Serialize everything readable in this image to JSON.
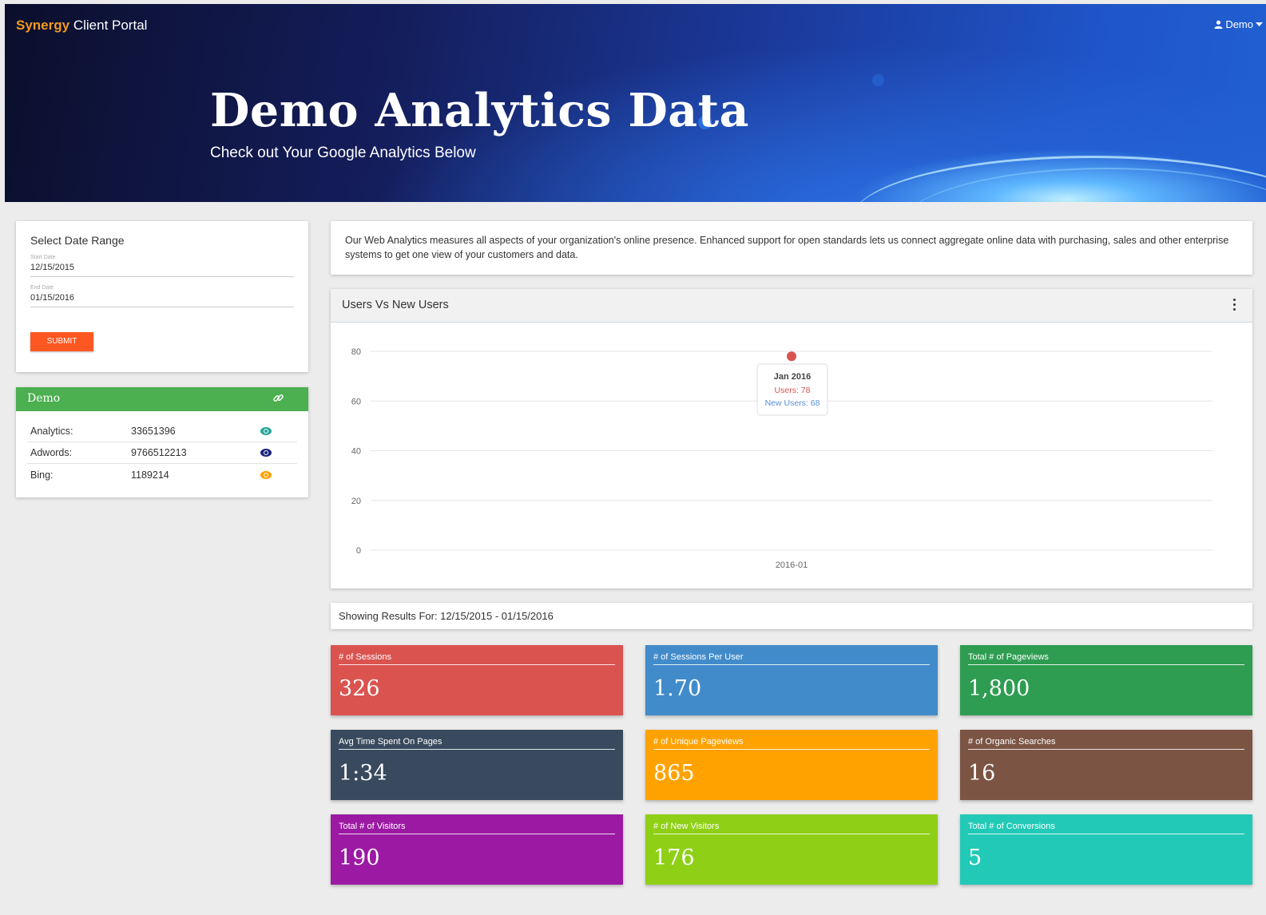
{
  "header": {
    "brand_accent": "Synergy",
    "brand_rest": "Client Portal",
    "user_label": "Demo",
    "title": "Demo Analytics Data",
    "subtitle": "Check out Your Google Analytics Below"
  },
  "date_range": {
    "title": "Select Date Range",
    "start_label": "Start Date",
    "start_value": "12/15/2015",
    "end_label": "End Date",
    "end_value": "01/15/2016",
    "submit_label": "SUBMIT"
  },
  "account": {
    "name": "Demo",
    "rows": [
      {
        "label": "Analytics:",
        "value": "33651396",
        "eye_color": "#26a69a"
      },
      {
        "label": "Adwords:",
        "value": "9766512213",
        "eye_color": "#1a237e"
      },
      {
        "label": "Bing:",
        "value": "1189214",
        "eye_color": "#ffa000"
      }
    ]
  },
  "description": "Our Web Analytics measures all aspects of your organization's online presence. Enhanced support for open standards lets us connect aggregate online data with purchasing, sales and other enterprise systems to get one view of your customers and data.",
  "chart_title": "Users Vs New Users",
  "chart_data": {
    "type": "line",
    "x": [
      "2016-01"
    ],
    "ylim": [
      0,
      80
    ],
    "yticks": [
      0,
      20,
      40,
      60,
      80
    ],
    "series": [
      {
        "name": "Users",
        "values": [
          78
        ],
        "color": "#d9534f"
      },
      {
        "name": "New Users",
        "values": [
          68
        ],
        "color": "#5b8fd6"
      }
    ],
    "tooltip": {
      "title": "Jan 2016",
      "users_text": "Users: 78",
      "new_users_text": "New Users: 68"
    },
    "grid": true
  },
  "results_text": "Showing Results For: 12/15/2015 - 01/15/2016",
  "stats": [
    {
      "title": "# of Sessions",
      "value": "326",
      "color": "#da534f"
    },
    {
      "title": "# of Sessions Per User",
      "value": "1.70",
      "color": "#428bca"
    },
    {
      "title": "Total # of Pageviews",
      "value": "1,800",
      "color": "#2e9d51"
    },
    {
      "title": "Avg Time Spent On Pages",
      "value": "1:34",
      "color": "#394a5e"
    },
    {
      "title": "# of Unique Pageviews",
      "value": "865",
      "color": "#ffa200"
    },
    {
      "title": "# of Organic Searches",
      "value": "16",
      "color": "#7b5444"
    },
    {
      "title": "Total # of Visitors",
      "value": "190",
      "color": "#9c1aa3"
    },
    {
      "title": "# of New Visitors",
      "value": "176",
      "color": "#8fd016"
    },
    {
      "title": "Total # of Conversions",
      "value": "5",
      "color": "#22c9b6"
    }
  ]
}
